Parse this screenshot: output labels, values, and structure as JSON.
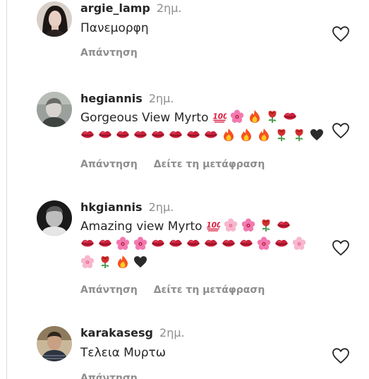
{
  "comments": [
    {
      "username": "argie_lamp",
      "time": "2ημ.",
      "text": "Πανεμορφη",
      "actions": [
        "Απάντηση"
      ],
      "emoji_lines": []
    },
    {
      "username": "hegiannis",
      "time": "2ημ.",
      "text": "Gorgeous View Myrto",
      "actions": [
        "Απάντηση",
        "Δείτε τη μετάφραση"
      ],
      "emoji_lines": [
        [
          "hundred-icon",
          "hibiscus-icon",
          "fire-icon",
          "rose-icon",
          "kiss-icon"
        ],
        [
          "kiss-icon",
          "kiss-icon",
          "kiss-icon",
          "kiss-icon",
          "kiss-icon",
          "kiss-icon",
          "kiss-icon",
          "kiss-icon",
          "fire-icon",
          "fire-icon",
          "fire-icon",
          "rose-icon",
          "rose-icon",
          "black-heart-icon"
        ]
      ]
    },
    {
      "username": "hkgiannis",
      "time": "2ημ.",
      "text": "Amazing view Myrto",
      "actions": [
        "Απάντηση",
        "Δείτε τη μετάφραση"
      ],
      "emoji_lines": [
        [
          "hundred-icon",
          "cherry-blossom-icon",
          "hibiscus-icon",
          "rose-icon",
          "kiss-icon"
        ],
        [
          "kiss-icon",
          "kiss-icon",
          "hibiscus-icon",
          "hibiscus-icon",
          "kiss-icon",
          "kiss-icon",
          "kiss-icon",
          "kiss-icon",
          "kiss-icon",
          "kiss-icon",
          "hibiscus-icon",
          "kiss-icon",
          "cherry-blossom-icon"
        ],
        [
          "cherry-blossom-icon",
          "rose-icon",
          "fire-icon",
          "black-heart-icon"
        ]
      ]
    },
    {
      "username": "karakasesg",
      "time": "2ημ.",
      "text": "Τελεια Μυρτω",
      "actions": [
        "Απάντηση"
      ],
      "emoji_lines": []
    }
  ],
  "colors": {
    "text": "#262626",
    "secondary": "#8e8e8e",
    "divider": "#dbdbdb"
  }
}
